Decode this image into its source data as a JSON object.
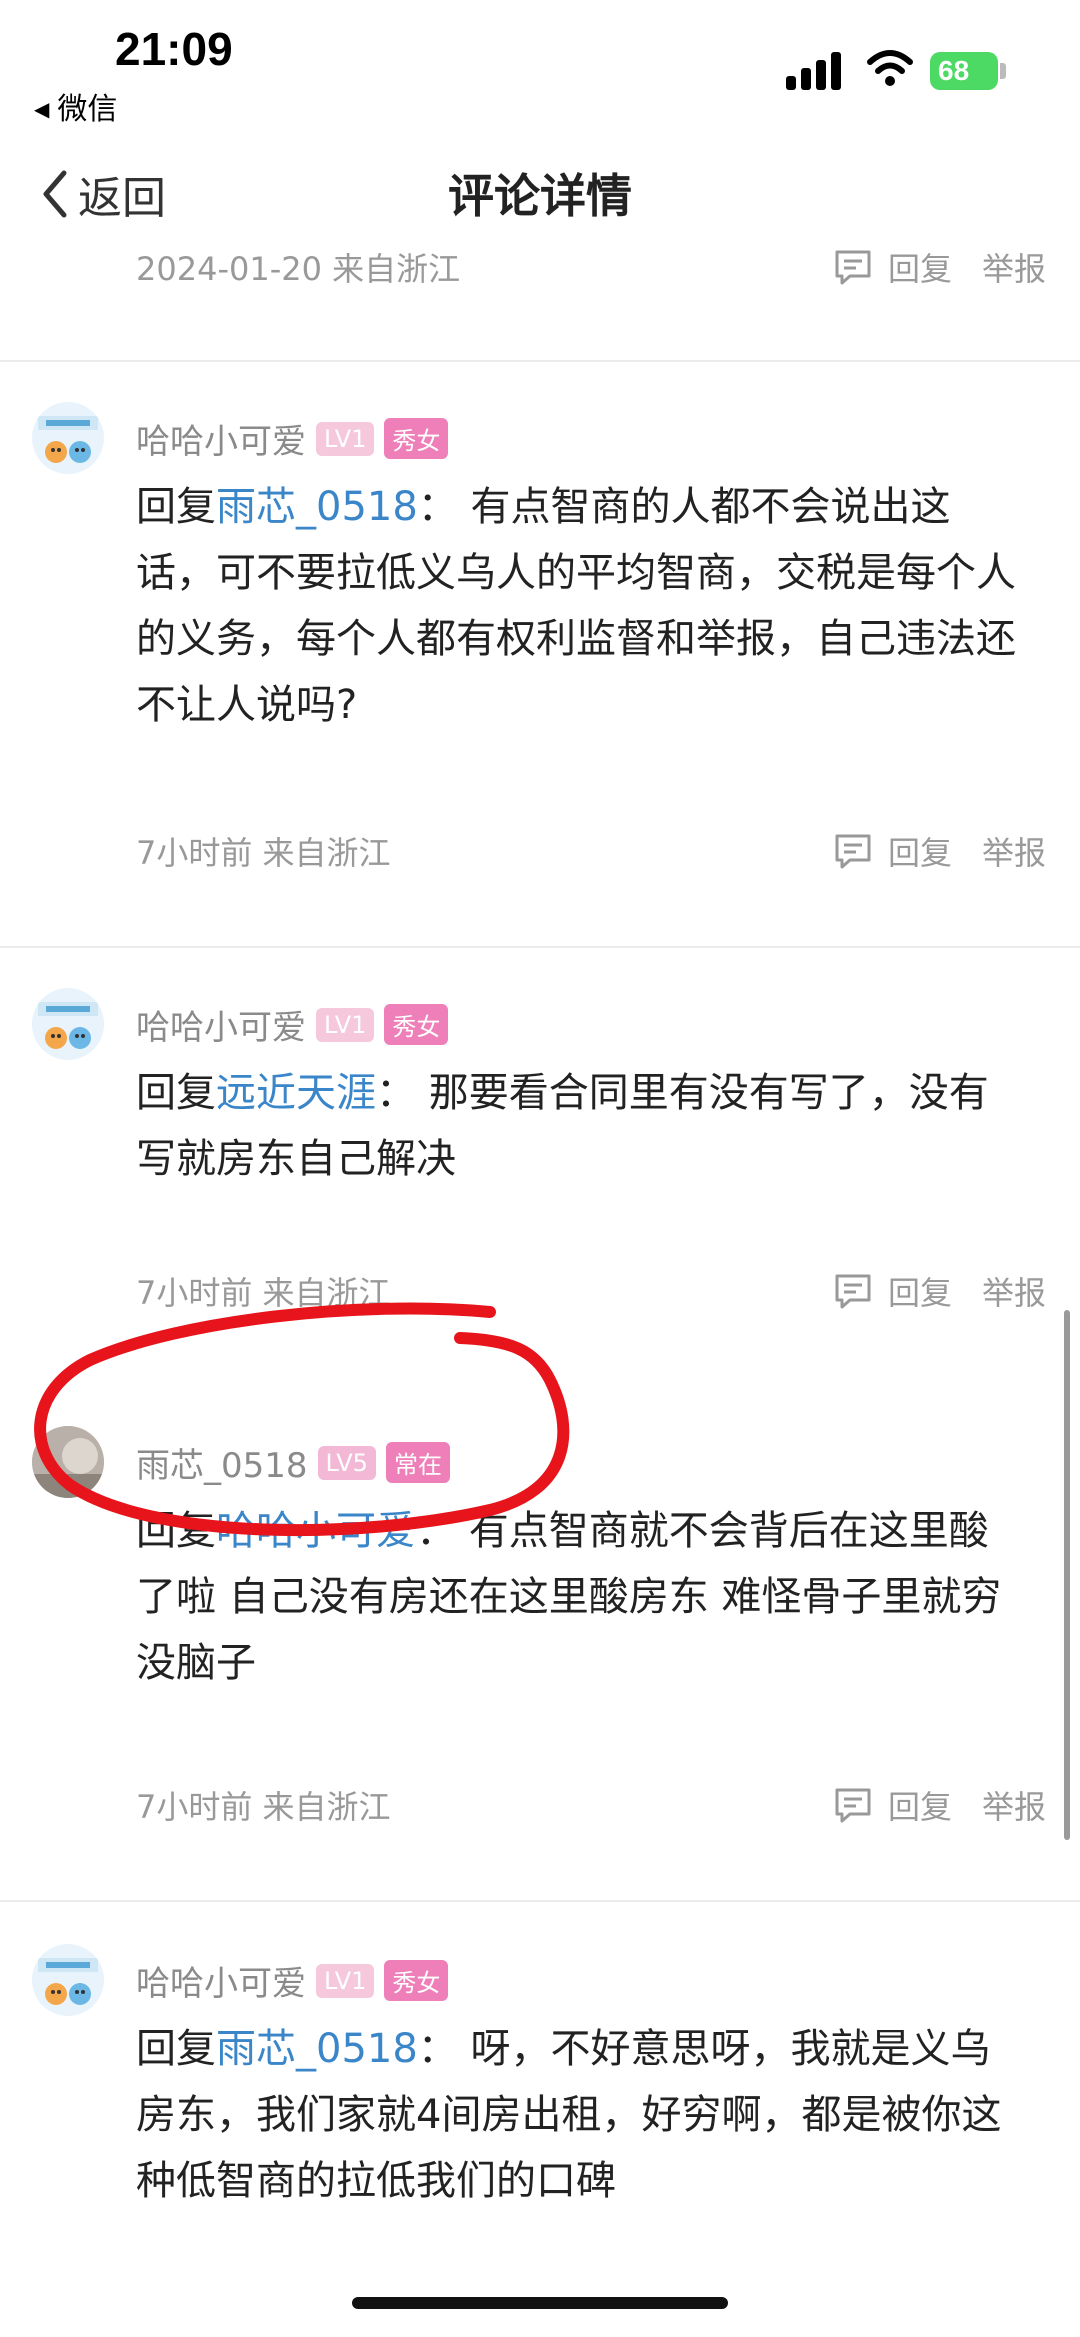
{
  "status_bar": {
    "time": "21:09",
    "back_app": "微信",
    "battery": "68"
  },
  "nav": {
    "back_label": "返回",
    "title": "评论详情"
  },
  "top_meta": {
    "meta": "2024-01-20 来自浙江",
    "reply": "回复",
    "report": "举报"
  },
  "comments": [
    {
      "user": "哈哈小可爱",
      "level": "LV1",
      "tag": "秀女",
      "reply_prefix": "回复",
      "reply_to": "雨芯_0518",
      "sep": "：",
      "text": "有点智商的人都不会说出这话，可不要拉低义乌人的平均智商，交税是每个人的义务，每个人都有权利监督和举报，自己违法还不让人说吗?",
      "meta": "7小时前 来自浙江",
      "reply": "回复",
      "report": "举报"
    },
    {
      "user": "哈哈小可爱",
      "level": "LV1",
      "tag": "秀女",
      "reply_prefix": "回复",
      "reply_to": "远近天涯",
      "sep": "：",
      "text": "那要看合同里有没有写了，没有写就房东自己解决",
      "meta": "7小时前 来自浙江",
      "reply": "回复",
      "report": "举报"
    },
    {
      "user": "雨芯_0518",
      "level": "LV5",
      "tag": "常在",
      "reply_prefix": "回复",
      "reply_to": "哈哈小可爱",
      "sep": "：",
      "text": "有点智商就不会背后在这里酸了啦 自己没有房还在这里酸房东 难怪骨子里就穷 没脑子",
      "meta": "7小时前 来自浙江",
      "reply": "回复",
      "report": "举报"
    },
    {
      "user": "哈哈小可爱",
      "level": "LV1",
      "tag": "秀女",
      "reply_prefix": "回复",
      "reply_to": "雨芯_0518",
      "sep": "：",
      "text": "呀，不好意思呀，我就是义乌房东，我们家就4间房出租，好穷啊，都是被你这种低智商的拉低我们的口碑"
    }
  ],
  "colors": {
    "mention": "#3a86c8",
    "annotation": "#e8141b",
    "tag": "#ee7fb8"
  }
}
